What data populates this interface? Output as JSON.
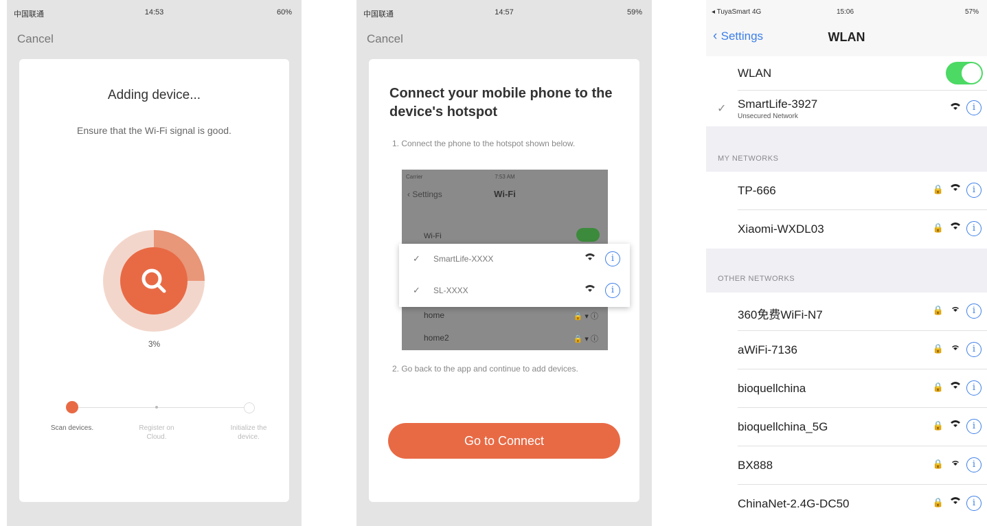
{
  "panel1": {
    "status": {
      "carrier": "中国联通",
      "time": "14:53",
      "battery": "60%"
    },
    "cancel": "Cancel",
    "title": "Adding device...",
    "subtitle": "Ensure that the Wi-Fi signal is good.",
    "progress_percent": 3,
    "progress_label": "3%",
    "steps": [
      {
        "label": "Scan devices."
      },
      {
        "label": "Register on Cloud."
      },
      {
        "label": "Initialize the device."
      }
    ],
    "accent": "#e86a45"
  },
  "panel2": {
    "status": {
      "carrier": "中国联通",
      "time": "14:57",
      "battery": "59%"
    },
    "cancel": "Cancel",
    "title": "Connect your mobile phone to the device's hotspot",
    "step1": "1. Connect the phone to the hotspot shown below.",
    "mock": {
      "status": "Carrier",
      "time": "7:53 AM",
      "back": "Settings",
      "title": "Wi-Fi",
      "wifi_label": "Wi-Fi",
      "rows": [
        "home",
        "home2"
      ]
    },
    "popup_networks": [
      "SmartLife-XXXX",
      "SL-XXXX"
    ],
    "step2": "2. Go back to the app and continue to add devices.",
    "button": "Go to Connect"
  },
  "panel3": {
    "status": {
      "carrier": "TuyaSmart",
      "network": "4G",
      "time": "15:06",
      "battery": "57%"
    },
    "back": "Settings",
    "title": "WLAN",
    "wlan_label": "WLAN",
    "wlan_on": true,
    "connected": {
      "name": "SmartLife-3927",
      "note": "Unsecured Network"
    },
    "my_networks_header": "MY NETWORKS",
    "my_networks": [
      "TP-666",
      "Xiaomi-WXDL03"
    ],
    "other_networks_header": "OTHER NETWORKS",
    "other_networks": [
      "360免费WiFi-N7",
      "aWiFi-7136",
      "bioquellchina",
      "bioquellchina_5G",
      "BX888",
      "ChinaNet-2.4G-DC50"
    ]
  }
}
